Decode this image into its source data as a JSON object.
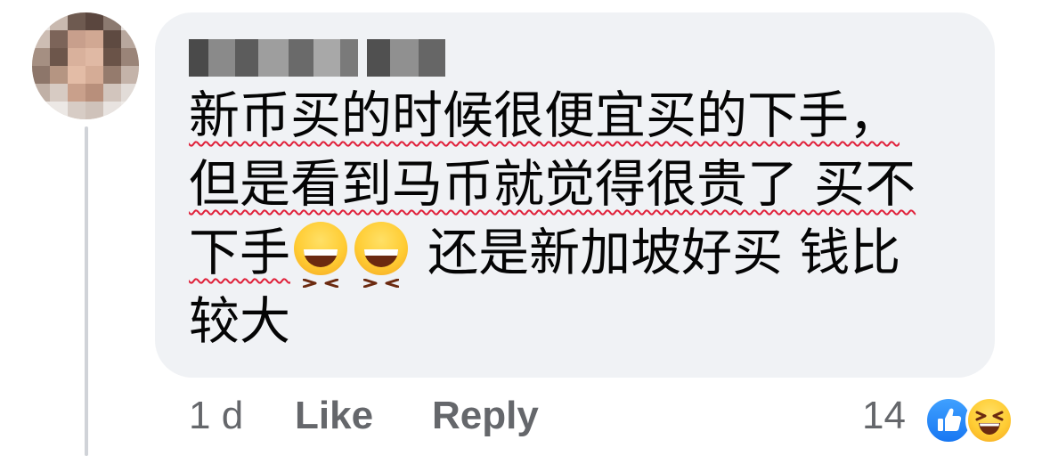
{
  "comment": {
    "text_lines": [
      [
        {
          "text": "新币买的时候很便宜买的下手，",
          "underline": true
        }
      ],
      [
        {
          "text": "但是看到马币就觉得很贵了 买不",
          "underline": true
        }
      ],
      [
        {
          "text": "下手",
          "underline": true
        },
        {
          "emoji": "grinning-squinting-face"
        },
        {
          "emoji": "grinning-squinting-face"
        },
        {
          "text": " 还是新加坡好买 钱比",
          "underline": false
        }
      ],
      [
        {
          "text": "较大",
          "underline": false
        }
      ]
    ]
  },
  "footer": {
    "time": "1 d",
    "like_label": "Like",
    "reply_label": "Reply",
    "reaction_count": "14",
    "reactions": [
      "like-icon",
      "haha-icon"
    ]
  },
  "colors": {
    "bubble": "#f0f2f5",
    "text": "#050505",
    "meta": "#65676b",
    "spell_underline": "#e0213a",
    "like_blue": "#1877f2",
    "thread_line": "#d0d3d8"
  },
  "author": {
    "name_state": "pixelated"
  }
}
